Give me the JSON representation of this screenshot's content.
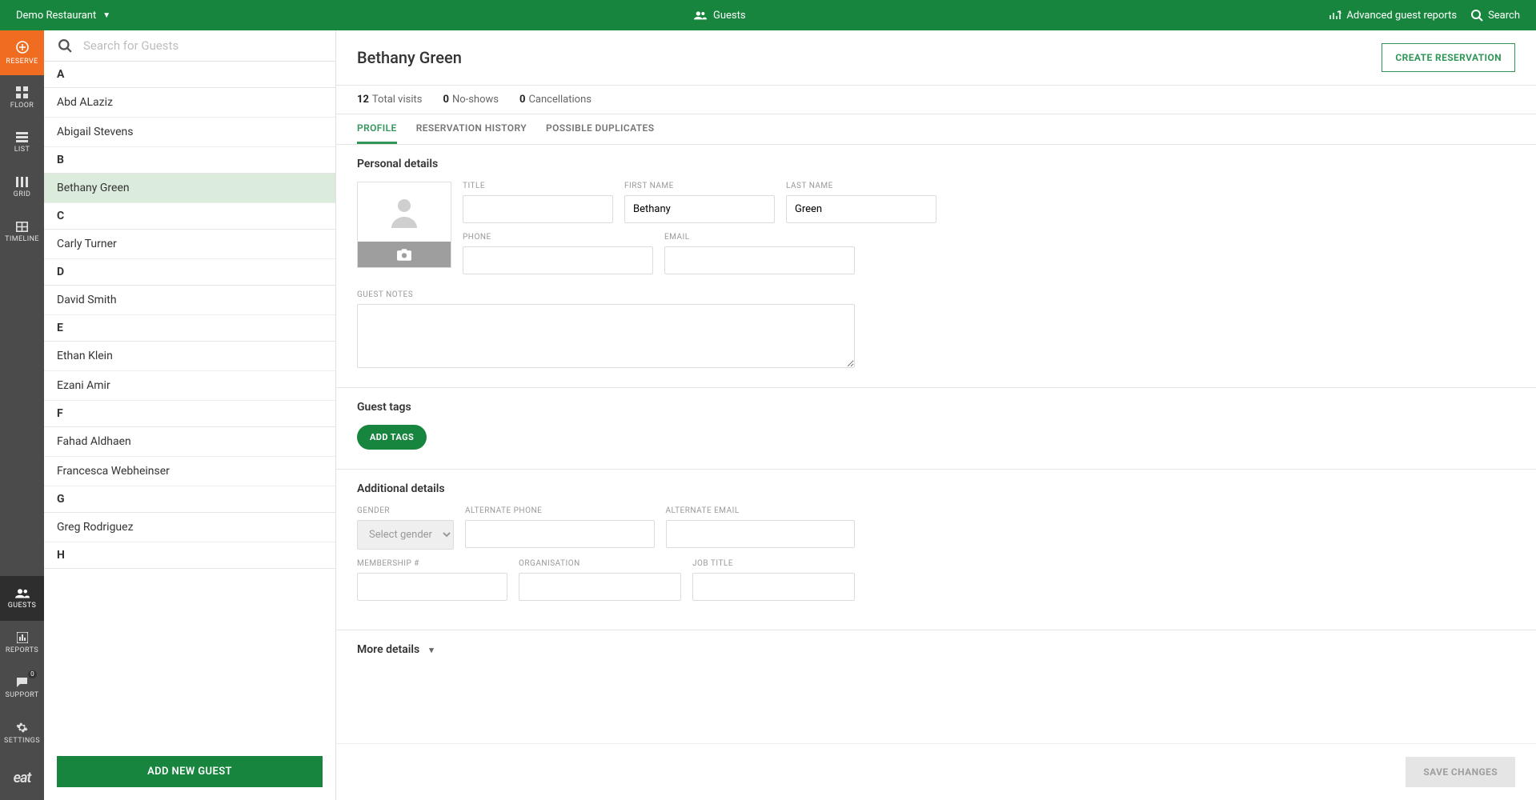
{
  "topbar": {
    "restaurant": "Demo Restaurant",
    "center_label": "Guests",
    "advanced_reports": "Advanced guest reports",
    "search": "Search"
  },
  "sidenav": {
    "reserve": "RESERVE",
    "floor": "FLOOR",
    "list": "LIST",
    "grid": "GRID",
    "timeline": "TIMELINE",
    "guests": "GUESTS",
    "reports": "REPORTS",
    "support": "SUPPORT",
    "support_badge": "0",
    "settings": "SETTINGS",
    "logo": "eat"
  },
  "guest_list": {
    "search_placeholder": "Search for Guests",
    "groups": [
      {
        "letter": "A",
        "items": [
          "Abd ALaziz",
          "Abigail Stevens"
        ]
      },
      {
        "letter": "B",
        "items": [
          "Bethany Green"
        ]
      },
      {
        "letter": "C",
        "items": [
          "Carly Turner"
        ]
      },
      {
        "letter": "D",
        "items": [
          "David Smith"
        ]
      },
      {
        "letter": "E",
        "items": [
          "Ethan Klein",
          "Ezani Amir"
        ]
      },
      {
        "letter": "F",
        "items": [
          "Fahad Aldhaen",
          "Francesca Webheinser"
        ]
      },
      {
        "letter": "G",
        "items": [
          "Greg Rodriguez"
        ]
      },
      {
        "letter": "H",
        "items": []
      }
    ],
    "selected": "Bethany Green",
    "add_new": "ADD NEW GUEST"
  },
  "detail": {
    "name": "Bethany Green",
    "create_reservation": "CREATE RESERVATION",
    "stats": {
      "visits_count": "12",
      "visits_label": "Total visits",
      "noshows_count": "0",
      "noshows_label": "No-shows",
      "cancel_count": "0",
      "cancel_label": "Cancellations"
    },
    "tabs": {
      "profile": "PROFILE",
      "history": "RESERVATION HISTORY",
      "duplicates": "POSSIBLE DUPLICATES"
    },
    "personal": {
      "title": "Personal details",
      "labels": {
        "title": "TITLE",
        "first_name": "FIRST NAME",
        "last_name": "LAST NAME",
        "phone": "PHONE",
        "email": "EMAIL",
        "notes": "GUEST NOTES"
      },
      "values": {
        "title": "",
        "first_name": "Bethany",
        "last_name": "Green",
        "phone": "",
        "email": "",
        "notes": ""
      }
    },
    "tags": {
      "title": "Guest tags",
      "add": "ADD TAGS"
    },
    "additional": {
      "title": "Additional details",
      "labels": {
        "gender": "GENDER",
        "alt_phone": "ALTERNATE PHONE",
        "alt_email": "ALTERNATE EMAIL",
        "membership": "MEMBERSHIP #",
        "organisation": "ORGANISATION",
        "job_title": "JOB TITLE"
      },
      "gender_placeholder": "Select gender"
    },
    "more": "More details",
    "save": "SAVE CHANGES"
  }
}
